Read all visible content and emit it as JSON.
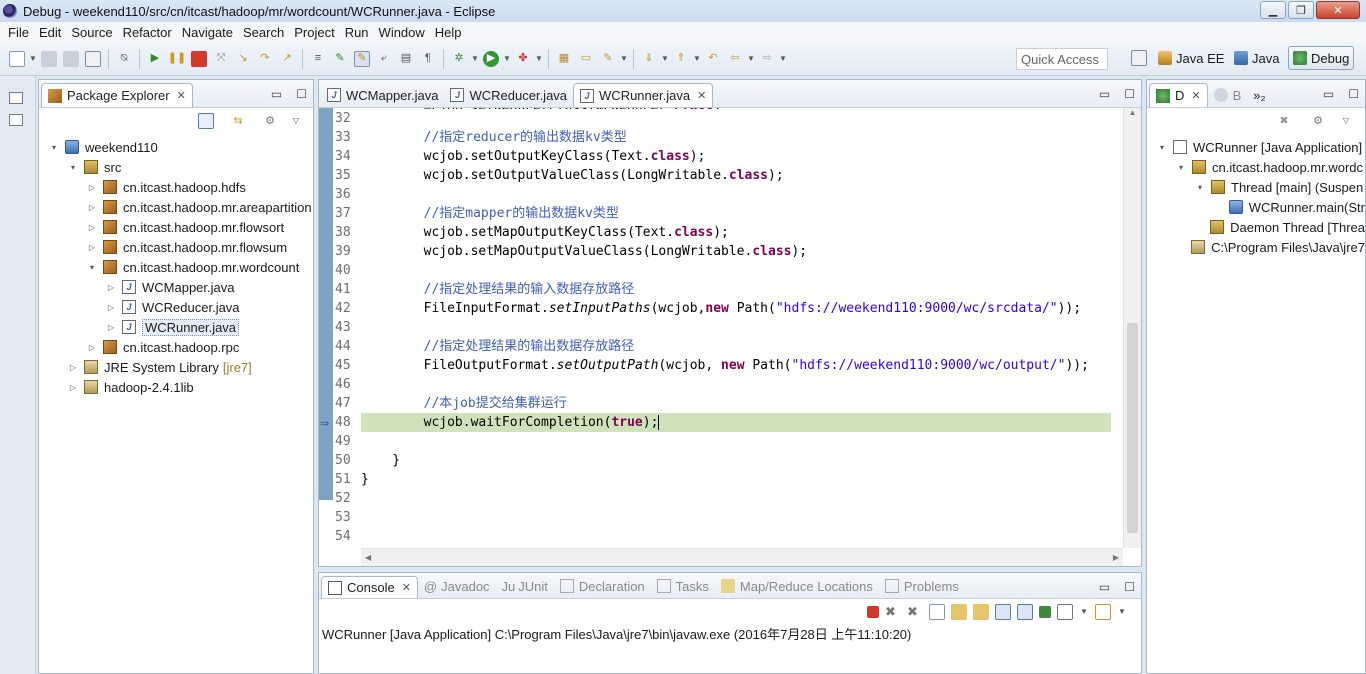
{
  "window": {
    "title": "Debug - weekend110/src/cn/itcast/hadoop/mr/wordcount/WCRunner.java - Eclipse",
    "minimize": "▁",
    "maximize": "❐",
    "close": "✕"
  },
  "menu": [
    "File",
    "Edit",
    "Source",
    "Refactor",
    "Navigate",
    "Search",
    "Project",
    "Run",
    "Window",
    "Help"
  ],
  "toolbar": {
    "quick_access": "Quick Access",
    "perspectives": [
      "Java EE",
      "Java",
      "Debug"
    ]
  },
  "package_explorer": {
    "title": "Package Explorer",
    "tree": [
      {
        "label": "weekend110",
        "depth": 0,
        "icon": "project-icon",
        "twisty": "▾"
      },
      {
        "label": "src",
        "depth": 1,
        "icon": "source-folder-icon",
        "twisty": "▾"
      },
      {
        "label": "cn.itcast.hadoop.hdfs",
        "depth": 2,
        "icon": "package-icon",
        "twisty": "▷"
      },
      {
        "label": "cn.itcast.hadoop.mr.areapartition",
        "depth": 2,
        "icon": "package-icon",
        "twisty": "▷"
      },
      {
        "label": "cn.itcast.hadoop.mr.flowsort",
        "depth": 2,
        "icon": "package-icon",
        "twisty": "▷"
      },
      {
        "label": "cn.itcast.hadoop.mr.flowsum",
        "depth": 2,
        "icon": "package-icon",
        "twisty": "▷"
      },
      {
        "label": "cn.itcast.hadoop.mr.wordcount",
        "depth": 2,
        "icon": "package-icon",
        "twisty": "▾"
      },
      {
        "label": "WCMapper.java",
        "depth": 3,
        "icon": "java-file-icon",
        "twisty": "▷"
      },
      {
        "label": "WCReducer.java",
        "depth": 3,
        "icon": "java-file-icon",
        "twisty": "▷"
      },
      {
        "label": "WCRunner.java",
        "depth": 3,
        "icon": "java-file-icon",
        "twisty": "▷",
        "selected": true
      },
      {
        "label": "cn.itcast.hadoop.rpc",
        "depth": 2,
        "icon": "package-icon",
        "twisty": "▷"
      },
      {
        "label": "JRE System Library",
        "depth": 1,
        "icon": "library-icon",
        "twisty": "▷",
        "decoration": "[jre7]"
      },
      {
        "label": "hadoop-2.4.1lib",
        "depth": 1,
        "icon": "library-icon",
        "twisty": "▷"
      }
    ]
  },
  "editor": {
    "tabs": [
      {
        "label": "WCMapper.java",
        "active": false
      },
      {
        "label": "WCReducer.java",
        "active": false
      },
      {
        "label": "WCRunner.java",
        "active": true
      }
    ],
    "line_numbers": [
      "32",
      "33",
      "34",
      "35",
      "36",
      "37",
      "38",
      "39",
      "40",
      "41",
      "42",
      "43",
      "44",
      "45",
      "46",
      "47",
      "48",
      "49",
      "50",
      "51",
      "52",
      "53",
      "54"
    ],
    "lines": {
      "l33": "        //指定reducer的输出数据kv类型",
      "l34_a": "        wcjob.setOutputKeyClass(Text.",
      "l34_kw": "class",
      "l34_b": ");",
      "l35_a": "        wcjob.setOutputValueClass(LongWritable.",
      "l35_kw": "class",
      "l35_b": ");",
      "l37": "        //指定mapper的输出数据kv类型",
      "l38_a": "        wcjob.setMapOutputKeyClass(Text.",
      "l38_kw": "class",
      "l38_b": ");",
      "l39_a": "        wcjob.setMapOutputValueClass(LongWritable.",
      "l39_kw": "class",
      "l39_b": ");",
      "l41": "        //指定处理结果的输入数据存放路径",
      "l42_a": "        FileInputFormat.",
      "l42_m": "setInputPaths",
      "l42_b": "(wcjob,",
      "l42_kw": "new",
      "l42_c": " Path(",
      "l42_s": "\"hdfs://weekend110:9000/wc/srcdata/\"",
      "l42_d": "));",
      "l44": "        //指定处理结果的输出数据存放路径",
      "l45_a": "        FileOutputFormat.",
      "l45_m": "setOutputPath",
      "l45_b": "(wcjob, ",
      "l45_kw": "new",
      "l45_c": " Path(",
      "l45_s": "\"hdfs://weekend110:9000/wc/output/\"",
      "l45_d": "));",
      "l47": "        //本job提交给集群运行",
      "l48_a": "        wcjob.waitForCompletion(",
      "l48_kw": "true",
      "l48_b": ");",
      "l50": "    }",
      "l51": "}"
    },
    "current_line_marker": "⇒"
  },
  "console": {
    "tabs": [
      "Console",
      "Javadoc",
      "JUnit",
      "Declaration",
      "Tasks",
      "Map/Reduce Locations",
      "Problems"
    ],
    "tab_prefixes": [
      "",
      "@",
      "Ju",
      "",
      "",
      "",
      ""
    ],
    "text": "WCRunner [Java Application] C:\\Program Files\\Java\\jre7\\bin\\javaw.exe (2016年7月28日 上午11:10:20)"
  },
  "debug_view": {
    "tabs": [
      "D",
      "B",
      "»₂"
    ],
    "tree": [
      {
        "label": "WCRunner [Java Application]",
        "depth": 0,
        "icon": "launch-icon",
        "twisty": "▾"
      },
      {
        "label": "cn.itcast.hadoop.mr.wordc",
        "depth": 1,
        "icon": "process-icon",
        "twisty": "▾"
      },
      {
        "label": "Thread [main] (Suspen",
        "depth": 2,
        "icon": "thread-suspended-icon",
        "twisty": "▾"
      },
      {
        "label": "WCRunner.main(Str",
        "depth": 3,
        "icon": "stack-frame-icon",
        "twisty": ""
      },
      {
        "label": "Daemon Thread [Threa",
        "depth": 2,
        "icon": "thread-icon",
        "twisty": ""
      },
      {
        "label": "C:\\Program Files\\Java\\jre7",
        "depth": 1,
        "icon": "process-path-icon",
        "twisty": ""
      }
    ]
  },
  "colors": {
    "comment": "#3f5fbf",
    "keyword": "#7f0055",
    "string": "#2a00ff",
    "debug_highlight": "#cfe3ba",
    "ruler": "#7ea3c3"
  }
}
